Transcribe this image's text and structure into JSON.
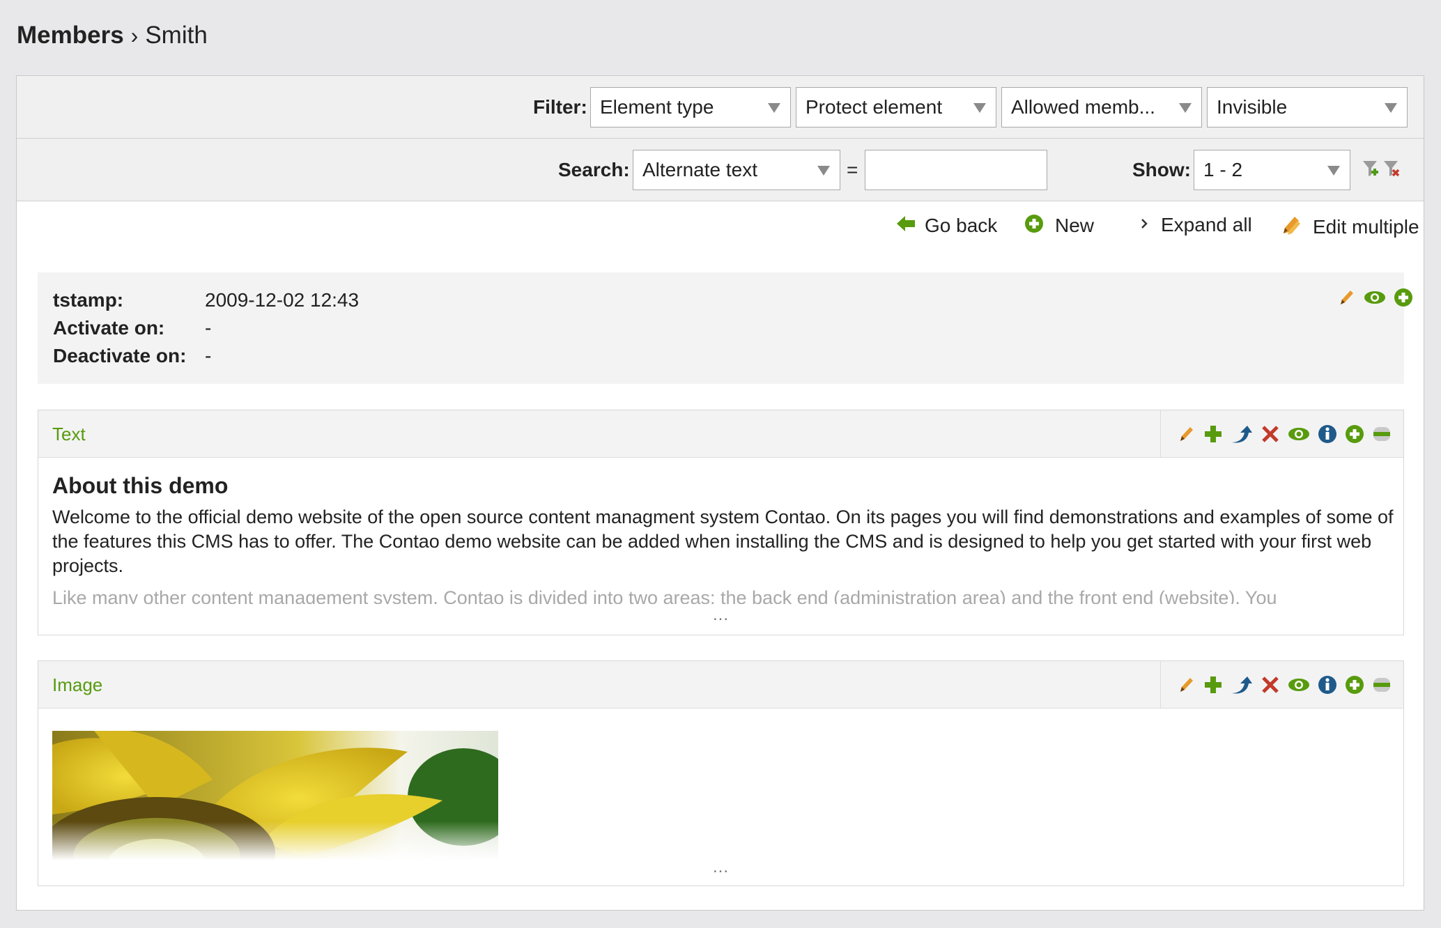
{
  "breadcrumb": {
    "parent": "Members",
    "separator": "›",
    "current": "Smith"
  },
  "filter": {
    "label": "Filter:",
    "selects": [
      "Element type",
      "Protect element",
      "Allowed memb...",
      "Invisible"
    ]
  },
  "search": {
    "label": "Search:",
    "field": "Alternate text",
    "equals": "=",
    "value": "",
    "show_label": "Show:",
    "show_value": "1 - 2"
  },
  "actions": {
    "go_back": "Go back",
    "new": "New",
    "expand_all": "Expand all",
    "edit_multiple": "Edit multiple"
  },
  "header": {
    "fields": [
      {
        "key": "tstamp:",
        "value": "2009-12-02 12:43"
      },
      {
        "key": "Activate on:",
        "value": "-"
      },
      {
        "key": "Deactivate on:",
        "value": "-"
      }
    ]
  },
  "elements": [
    {
      "type": "Text",
      "heading": "About this demo",
      "text": "Welcome to the official demo website of the open source content managment system Contao. On its pages you will find demonstrations and examples of some of the features this CMS has to offer. The Contao demo website can be added when installing the CMS and is designed to help you get started with your first web projects.",
      "text_faded": "Like many other content management system, Contao is divided into two areas: the back end (administration area) and the front end (website). You",
      "more": "..."
    },
    {
      "type": "Image",
      "image_alt": "sunflower photo",
      "more": "..."
    }
  ],
  "colors": {
    "accent_green": "#589b0e",
    "edit_orange": "#e79a2a",
    "delete_red": "#c23a2a",
    "info_blue": "#1f5a8a"
  }
}
